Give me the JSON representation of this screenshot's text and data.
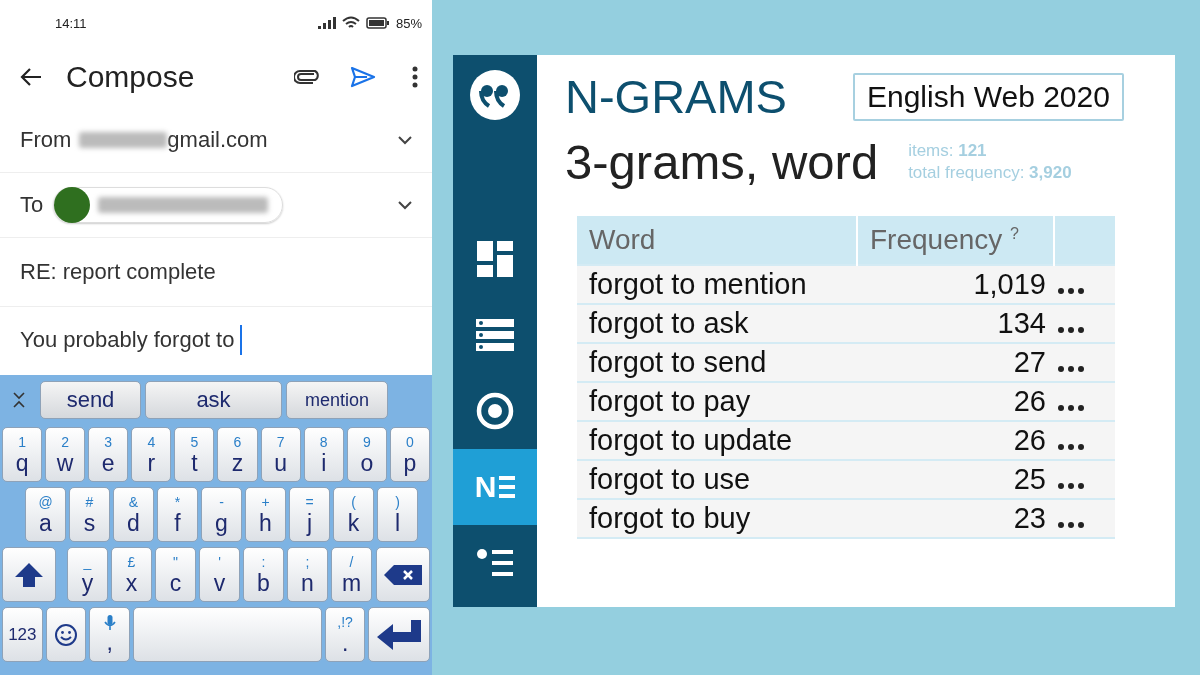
{
  "phone": {
    "status_bar": {
      "time": "14:11",
      "battery": "85%"
    },
    "app_bar": {
      "title": "Compose"
    },
    "from": {
      "label": "From",
      "address_visible": "gmail.com"
    },
    "to": {
      "label": "To"
    },
    "subject": "RE: report complete",
    "body": "You probably forgot to",
    "keyboard": {
      "suggestions": [
        "send",
        "ask",
        "mention"
      ],
      "rows": [
        [
          {
            "kind": "letter",
            "label": "q",
            "hint": "1"
          },
          {
            "kind": "letter",
            "label": "w",
            "hint": "2"
          },
          {
            "kind": "letter",
            "label": "e",
            "hint": "3"
          },
          {
            "kind": "letter",
            "label": "r",
            "hint": "4"
          },
          {
            "kind": "letter",
            "label": "t",
            "hint": "5"
          },
          {
            "kind": "letter",
            "label": "z",
            "hint": "6"
          },
          {
            "kind": "letter",
            "label": "u",
            "hint": "7"
          },
          {
            "kind": "letter",
            "label": "i",
            "hint": "8"
          },
          {
            "kind": "letter",
            "label": "o",
            "hint": "9"
          },
          {
            "kind": "letter",
            "label": "p",
            "hint": "0"
          }
        ],
        [
          {
            "kind": "letter",
            "label": "a",
            "hint": "@"
          },
          {
            "kind": "letter",
            "label": "s",
            "hint": "#"
          },
          {
            "kind": "letter",
            "label": "d",
            "hint": "&"
          },
          {
            "kind": "letter",
            "label": "f",
            "hint": "*"
          },
          {
            "kind": "letter",
            "label": "g",
            "hint": "-"
          },
          {
            "kind": "letter",
            "label": "h",
            "hint": "+"
          },
          {
            "kind": "letter",
            "label": "j",
            "hint": "="
          },
          {
            "kind": "letter",
            "label": "k",
            "hint": "("
          },
          {
            "kind": "letter",
            "label": "l",
            "hint": ")"
          }
        ],
        [
          {
            "kind": "shift"
          },
          {
            "kind": "letter",
            "label": "y",
            "hint": "_"
          },
          {
            "kind": "letter",
            "label": "x",
            "hint": "£"
          },
          {
            "kind": "letter",
            "label": "c",
            "hint": "\""
          },
          {
            "kind": "letter",
            "label": "v",
            "hint": "'"
          },
          {
            "kind": "letter",
            "label": "b",
            "hint": ":"
          },
          {
            "kind": "letter",
            "label": "n",
            "hint": ";"
          },
          {
            "kind": "letter",
            "label": "m",
            "hint": "/"
          },
          {
            "kind": "backspace"
          }
        ],
        [
          {
            "kind": "numbers",
            "label": "123"
          },
          {
            "kind": "emoji"
          },
          {
            "kind": "mic",
            "label": ","
          },
          {
            "kind": "space"
          },
          {
            "kind": "letter",
            "label": ".",
            "hint": ",!?"
          },
          {
            "kind": "enter"
          }
        ]
      ]
    }
  },
  "ngrams": {
    "sidebar": [
      {
        "kind": "logo",
        "selected": false
      },
      {
        "kind": "dashboard",
        "selected": false
      },
      {
        "kind": "list",
        "selected": false
      },
      {
        "kind": "target",
        "selected": false
      },
      {
        "kind": "ngram",
        "label": "N",
        "selected": true
      },
      {
        "kind": "bullets",
        "selected": false
      }
    ],
    "title": "N-GRAMS",
    "corpus": "English Web 2020",
    "subtitle": "3-grams, word",
    "stats": [
      "items: **121**",
      "total frequency: **3,920**"
    ],
    "table": {
      "columns": [
        "Word",
        "Frequency"
      ],
      "help": "?",
      "rows": [
        {
          "word": "forgot to mention",
          "frequency": "1,019"
        },
        {
          "word": "forgot to ask",
          "frequency": "134"
        },
        {
          "word": "forgot to send",
          "frequency": "27"
        },
        {
          "word": "forgot to pay",
          "frequency": "26"
        },
        {
          "word": "forgot to update",
          "frequency": "26"
        },
        {
          "word": "forgot to use",
          "frequency": "25"
        },
        {
          "word": "forgot to buy",
          "frequency": "23"
        }
      ]
    }
  }
}
